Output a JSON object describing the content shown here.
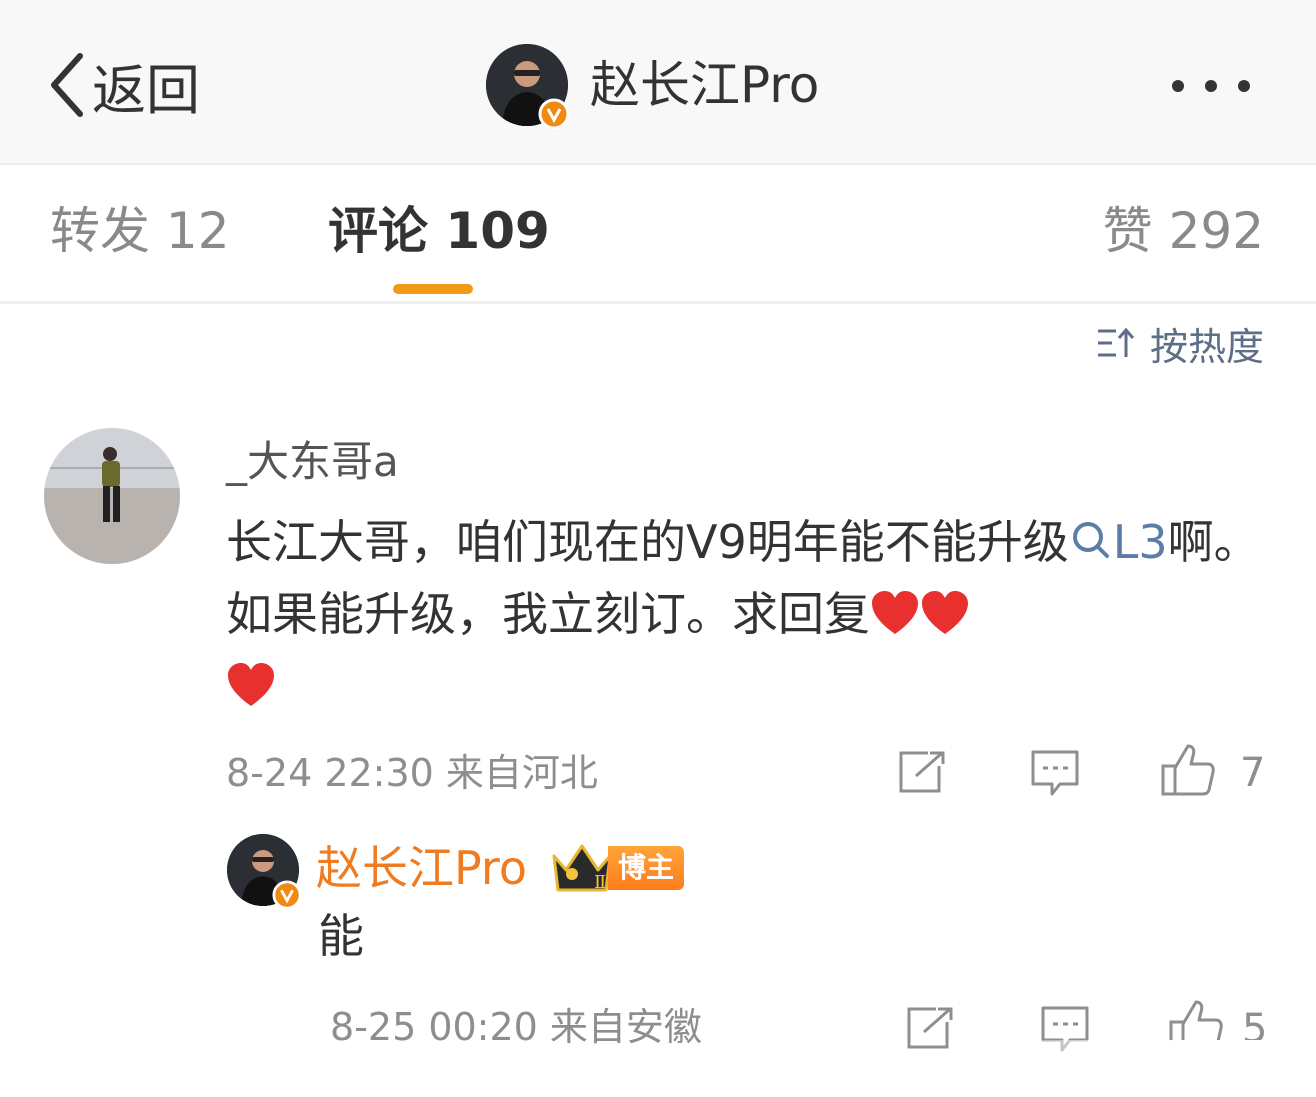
{
  "header": {
    "back_label": "返回",
    "username": "赵长江Pro"
  },
  "tabs": {
    "repost": "转发 12",
    "comment": "评论 109",
    "like": "赞 292"
  },
  "sort": {
    "label": "按热度"
  },
  "comment": {
    "username": "_大东哥a",
    "text_part1": "长江大哥，咱们现在的V9明年能不能升级",
    "link_text": "L3",
    "text_part2": "啊。如果能升级，我立刻订。求回复",
    "meta": "8-24 22:30 来自河北",
    "like_count": "7"
  },
  "reply": {
    "username": "赵长江Pro",
    "badge_level": "Ⅱ",
    "badge_label": "博主",
    "text": "能",
    "meta": "8-25 00:20 来自安徽",
    "like_count": "5"
  },
  "colors": {
    "accent": "#f29a17",
    "reply_name": "#f07c22",
    "link": "#5b7ea8",
    "heart": "#e8312f",
    "verified": "#f08a10"
  }
}
